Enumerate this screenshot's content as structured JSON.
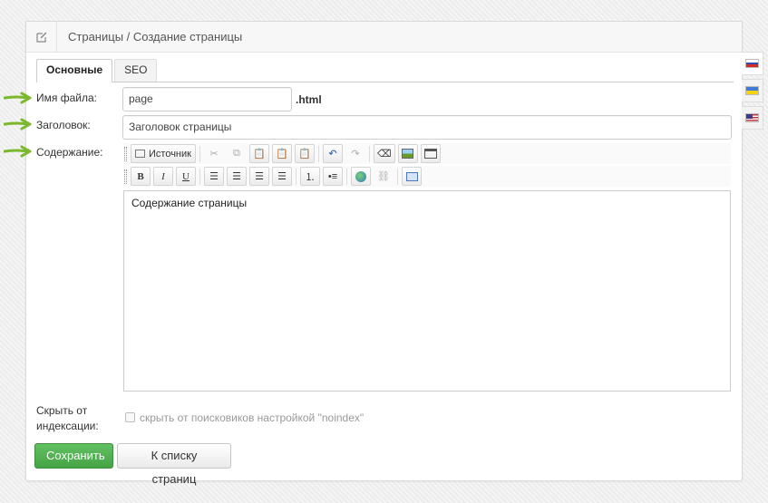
{
  "header": {
    "title": "Страницы / Создание страницы",
    "icon": "edit-icon"
  },
  "tabs": [
    {
      "label": "Основные",
      "active": true
    },
    {
      "label": "SEO",
      "active": false
    }
  ],
  "languages": [
    {
      "name": "Russian",
      "icon": "flag-ru-icon",
      "active": true
    },
    {
      "name": "Ukrainian",
      "icon": "flag-ua-icon",
      "active": false
    },
    {
      "name": "English",
      "icon": "flag-us-icon",
      "active": false
    }
  ],
  "form": {
    "filename_label": "Имя файла:",
    "filename_value": "page",
    "filename_suffix": ".html",
    "title_label": "Заголовок:",
    "title_value": "Заголовок страницы",
    "content_label": "Содержание:",
    "content_value": "Содержание страницы",
    "hide_label_line1": "Скрыть от",
    "hide_label_line2": "индексации:",
    "hide_checkbox_label": "скрыть от поисковиков настройкой \"noindex\"",
    "hide_checked": false
  },
  "editor_toolbar": {
    "source_label": "Источник",
    "bold": "B",
    "italic": "I",
    "underline": "U"
  },
  "buttons": {
    "save": "Сохранить",
    "back": "К списку страниц"
  },
  "colors": {
    "accent_green": "#45a345",
    "arrow_green": "#7ab82c"
  }
}
